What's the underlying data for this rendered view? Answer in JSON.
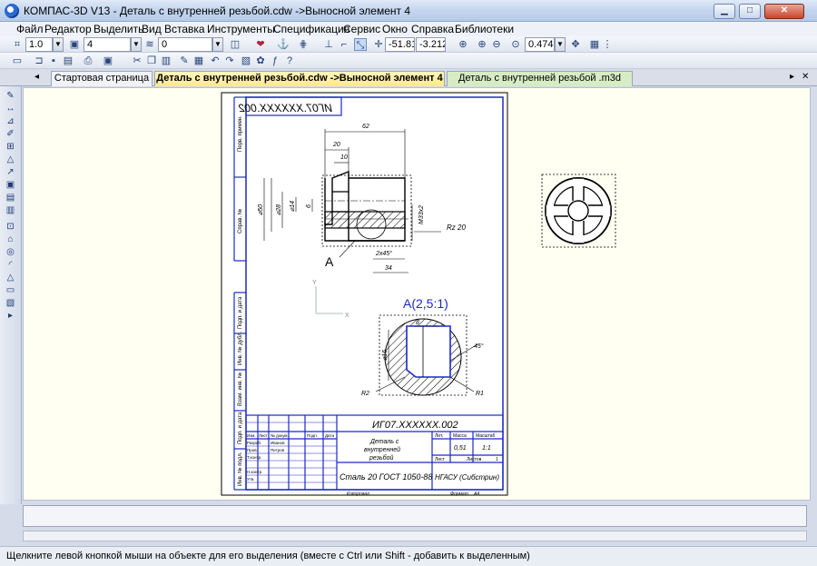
{
  "window": {
    "title": "КОМПАС-3D V13 - Деталь с внутренней резьбой.cdw ->Выносной элемент 4",
    "minimize_glyph": "▁",
    "maximize_glyph": "□",
    "close_glyph": "✕"
  },
  "menu": {
    "items": [
      "Файл",
      "Редактор",
      "Выделить",
      "Вид",
      "Вставка",
      "Инструменты",
      "Спецификация",
      "Сервис",
      "Окно",
      "Справка",
      "Библиотеки"
    ]
  },
  "toolbar1": {
    "step_value": "1.0",
    "style_value": "4",
    "layer_value": "0",
    "coord_x": "-51.81",
    "coord_y": "-3.212",
    "zoom": "0.474"
  },
  "tabs": [
    {
      "label": "Стартовая страница"
    },
    {
      "label": "Деталь с внутренней резьбой.cdw ->Выносной элемент 4"
    },
    {
      "label": "Деталь с внутренней резьбой .m3d"
    }
  ],
  "drawing": {
    "designation": "ИГ07.XXXXXX.002",
    "designation_mirrored": "ИГ07.XXXXXX.002",
    "part_name_line1": "Деталь с",
    "part_name_line2": "внутренней",
    "part_name_line3": "резьбой",
    "material": "Сталь 20  ГОСТ 1050-88",
    "organization": "НГАСУ (Сибстрин)",
    "mass": "0,51",
    "scale": "1:1",
    "sheet_label": "Лист",
    "sheets_label": "Листов",
    "sheets_value": "1",
    "lit_label": "Лит.",
    "mass_label": "Масса",
    "scale_label": "Масштаб",
    "row_labels": [
      "Изм.",
      "Лист",
      "№ докум.",
      "Подп.",
      "Дата"
    ],
    "row_names": [
      "Разраб.",
      "Пров.",
      "Т.контр.",
      "Н.контр.",
      "Утв."
    ],
    "developer": "Иванов",
    "checker": "Петров",
    "copied_label": "Копировал",
    "format_label": "Формат",
    "format_value": "А4",
    "side_labels": [
      "Перв. примен.",
      "Справ. №",
      "Подп. и дата",
      "Инв. № дубл.",
      "Взам. инв. №",
      "Подп. и дата",
      "Инв. № подл."
    ],
    "dim_62": "62",
    "dim_20": "20",
    "dim_10": "10",
    "dim_d50": "⌀50",
    "dim_d28": "⌀28",
    "dim_d14": "⌀14",
    "dim_6": "6",
    "dim_thread": "M33x2",
    "dim_chamfer": "2x45°",
    "dim_34": "34",
    "roughness": "Rz 20",
    "view_label_a": "А",
    "detail_label": "A(2,5:1)",
    "dim_8": "8",
    "dim_d16": "⌀16",
    "dim_45": "45°",
    "dim_r2": "R2",
    "dim_r1": "R1",
    "axis_x": "X",
    "axis_y": "Y"
  },
  "status": {
    "message": "Щелкните левой кнопкой мыши на объекте для его выделения (вместе с Ctrl или Shift - добавить к выделенным)"
  }
}
